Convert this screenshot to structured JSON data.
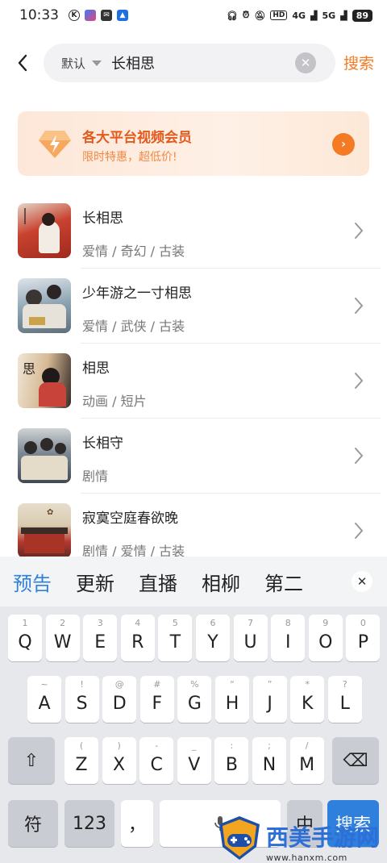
{
  "status": {
    "time": "10:33",
    "network_hd": "HD",
    "network_4g": "4G",
    "network_5g": "5G",
    "battery": "89"
  },
  "search": {
    "filter_label": "默认",
    "query": "长相思",
    "submit_label": "搜索",
    "clear_symbol": "✕"
  },
  "vip_banner": {
    "title": "各大平台视频会员",
    "subtitle": "限时特惠，超低价!",
    "go_symbol": "›"
  },
  "results": [
    {
      "title": "长相思",
      "tags": "爱情 / 奇幻 / 古装",
      "poster_colors": [
        "#b83a2a",
        "#e8ddd3"
      ]
    },
    {
      "title": "少年游之一寸相思",
      "tags": "爱情 / 武侠 / 古装",
      "poster_colors": [
        "#7f97a8",
        "#d9dee4"
      ]
    },
    {
      "title": "相思",
      "tags": "动画 / 短片",
      "poster_colors": [
        "#c7a684",
        "#2d2a2a"
      ]
    },
    {
      "title": "长相守",
      "tags": "剧情",
      "poster_colors": [
        "#5b6a7a",
        "#c7c7c0"
      ]
    },
    {
      "title": "寂寞空庭春欲晚",
      "tags": "剧情 / 爱情 / 古装",
      "poster_colors": [
        "#b64035",
        "#d7cfc0"
      ]
    }
  ],
  "keyboard": {
    "candidates": [
      "预告",
      "更新",
      "直播",
      "相柳",
      "第二"
    ],
    "close_symbol": "✕",
    "row1": [
      {
        "key": "Q",
        "hint": "1"
      },
      {
        "key": "W",
        "hint": "2"
      },
      {
        "key": "E",
        "hint": "3"
      },
      {
        "key": "R",
        "hint": "4"
      },
      {
        "key": "T",
        "hint": "5"
      },
      {
        "key": "Y",
        "hint": "6"
      },
      {
        "key": "U",
        "hint": "7"
      },
      {
        "key": "I",
        "hint": "8"
      },
      {
        "key": "O",
        "hint": "9"
      },
      {
        "key": "P",
        "hint": "0"
      }
    ],
    "row2": [
      {
        "key": "A",
        "hint": "~"
      },
      {
        "key": "S",
        "hint": "!"
      },
      {
        "key": "D",
        "hint": "@"
      },
      {
        "key": "F",
        "hint": "#"
      },
      {
        "key": "G",
        "hint": "%"
      },
      {
        "key": "H",
        "hint": "“"
      },
      {
        "key": "J",
        "hint": "”"
      },
      {
        "key": "K",
        "hint": "*"
      },
      {
        "key": "L",
        "hint": "?"
      }
    ],
    "row3": [
      {
        "key": "Z",
        "hint": "("
      },
      {
        "key": "X",
        "hint": ")"
      },
      {
        "key": "C",
        "hint": "-"
      },
      {
        "key": "V",
        "hint": "_"
      },
      {
        "key": "B",
        "hint": ":"
      },
      {
        "key": "N",
        "hint": ";"
      },
      {
        "key": "M",
        "hint": "/"
      }
    ],
    "shift_symbol": "⇧",
    "backspace_symbol": "⌫",
    "symbol_key": "符",
    "number_key": "123",
    "comma_key": "，",
    "lang_key": "中",
    "enter_key": "搜索"
  },
  "watermark": {
    "text": "西美手游网",
    "url": "www.hanxm.com"
  },
  "colors": {
    "accent": "#f47b23",
    "keyboard_accent": "#2f7fdc"
  }
}
